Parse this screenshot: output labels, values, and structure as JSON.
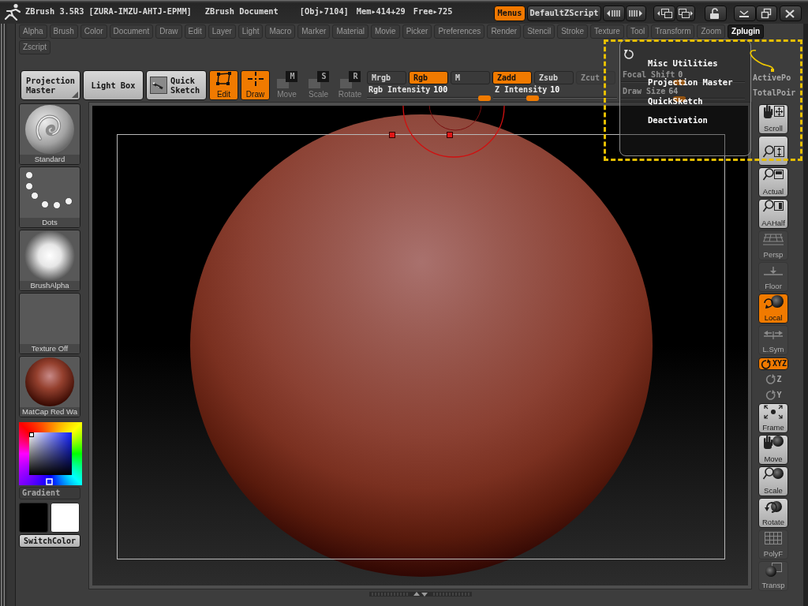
{
  "title_bar": {
    "title": "ZBrush 3.5R3 [ZURA-IMZU-AHTJ-EPMM]",
    "document": "ZBrush Document",
    "stats": [
      "[Obj▸7104]",
      "Mem▸414+29",
      "Free▸725"
    ],
    "toggles": [
      {
        "label": "Menus",
        "on": true
      },
      {
        "label": "DefaultZScript",
        "on": false
      }
    ]
  },
  "menu_bar": {
    "rows": [
      [
        {
          "label": "Alpha",
          "selected": false
        },
        {
          "label": "Brush",
          "selected": false
        },
        {
          "label": "Color",
          "selected": false
        },
        {
          "label": "Document",
          "selected": false
        },
        {
          "label": "Draw",
          "selected": false
        },
        {
          "label": "Edit",
          "selected": false
        },
        {
          "label": "Layer",
          "selected": false
        },
        {
          "label": "Light",
          "selected": false
        },
        {
          "label": "Macro",
          "selected": false
        },
        {
          "label": "Marker",
          "selected": false
        },
        {
          "label": "Material",
          "selected": false
        },
        {
          "label": "Movie",
          "selected": false
        },
        {
          "label": "Picker",
          "selected": false
        },
        {
          "label": "Preferences",
          "selected": false
        },
        {
          "label": "Render",
          "selected": false
        },
        {
          "label": "Stencil",
          "selected": false
        },
        {
          "label": "Stroke",
          "selected": false
        },
        {
          "label": "Texture",
          "selected": false
        },
        {
          "label": "Tool",
          "selected": false
        },
        {
          "label": "Transform",
          "selected": false
        },
        {
          "label": "Zoom",
          "selected": false
        },
        {
          "label": "Zplugin",
          "selected": true
        }
      ],
      [
        {
          "label": "Zscript",
          "selected": false
        }
      ]
    ]
  },
  "shelf": {
    "large_buttons": [
      {
        "label": "Projection Master",
        "kind": "menu"
      },
      {
        "label": "Light Box",
        "kind": "plain"
      },
      {
        "label": "Quick Sketch",
        "kind": "sketch"
      }
    ],
    "modes": [
      {
        "label": "Edit",
        "kind": "edit",
        "on": true
      },
      {
        "label": "Draw",
        "kind": "draw",
        "on": true
      },
      {
        "label": "Move",
        "kind": "move",
        "key": "M",
        "on": false
      },
      {
        "label": "Scale",
        "kind": "scale",
        "key": "S",
        "on": false
      },
      {
        "label": "Rotate",
        "kind": "rotate",
        "key": "R",
        "on": false
      }
    ],
    "channels": [
      {
        "label": "Mrgb",
        "on": false,
        "disabled": false
      },
      {
        "label": "Rgb",
        "on": true,
        "disabled": false
      },
      {
        "label": "M",
        "on": false,
        "disabled": false
      },
      {
        "label": "Zadd",
        "on": true,
        "disabled": false
      },
      {
        "label": "Zsub",
        "on": false,
        "disabled": false
      },
      {
        "label": "Zcut",
        "on": false,
        "disabled": true
      }
    ],
    "sliders": [
      {
        "label": "Rgb Intensity",
        "reading": "100",
        "level": 1
      },
      {
        "label": "Z Intensity",
        "reading": "10",
        "level": 0.3
      },
      {
        "label": "Focal Shift",
        "reading": "0",
        "level": 0.47
      },
      {
        "label": "Draw Size",
        "reading": "64",
        "level": 0.47
      }
    ],
    "stats": [
      "ActivePo",
      "TotalPoir"
    ]
  },
  "left_panel": {
    "items": [
      {
        "label": "Standard",
        "kind": "brush"
      },
      {
        "label": "Dots",
        "kind": "stroke"
      },
      {
        "label": "BrushAlpha",
        "kind": "alpha"
      },
      {
        "label": "Texture Off",
        "kind": "texture"
      },
      {
        "label": "MatCap Red Wa",
        "kind": "material"
      }
    ],
    "gradient": {
      "label": "Gradient",
      "on": false
    },
    "swatches": [
      {
        "color": "#000000"
      },
      {
        "color": "#ffffff"
      }
    ],
    "switch_color": "SwitchColor"
  },
  "view_buttons": [
    {
      "label": "Scroll",
      "kind": "scroll",
      "on": false
    },
    {
      "kind": "zoom",
      "on": false
    },
    {
      "label": "Actual",
      "kind": "actual",
      "on": false
    },
    {
      "label": "AAHalf",
      "kind": "aahalf",
      "on": false
    },
    {
      "label": "Persp",
      "kind": "persp",
      "on": false
    },
    {
      "label": "Floor",
      "kind": "floor",
      "on": false
    },
    {
      "label": "Local",
      "kind": "local",
      "on": true
    },
    {
      "label": "L.Sym",
      "kind": "lsym",
      "on": false
    },
    {
      "label": "XYZ",
      "kind": "xyz",
      "on": true
    },
    {
      "label": "Z",
      "kind": "rot-z",
      "on": false
    },
    {
      "label": "Y",
      "kind": "rot-y",
      "on": false
    },
    {
      "label": "Frame",
      "kind": "frame",
      "on": false
    },
    {
      "label": "Move",
      "kind": "move",
      "on": false
    },
    {
      "label": "Scale",
      "kind": "scale",
      "on": false
    },
    {
      "label": "Rotate",
      "kind": "rotate",
      "on": false
    },
    {
      "label": "PolyF",
      "kind": "polyf",
      "on": false
    },
    {
      "label": "Transp",
      "kind": "transp",
      "on": false
    }
  ],
  "zplugin_menu": {
    "items": [
      "Misc Utilities",
      "Projection Master",
      "QuickSketch",
      "Deactivation"
    ]
  }
}
